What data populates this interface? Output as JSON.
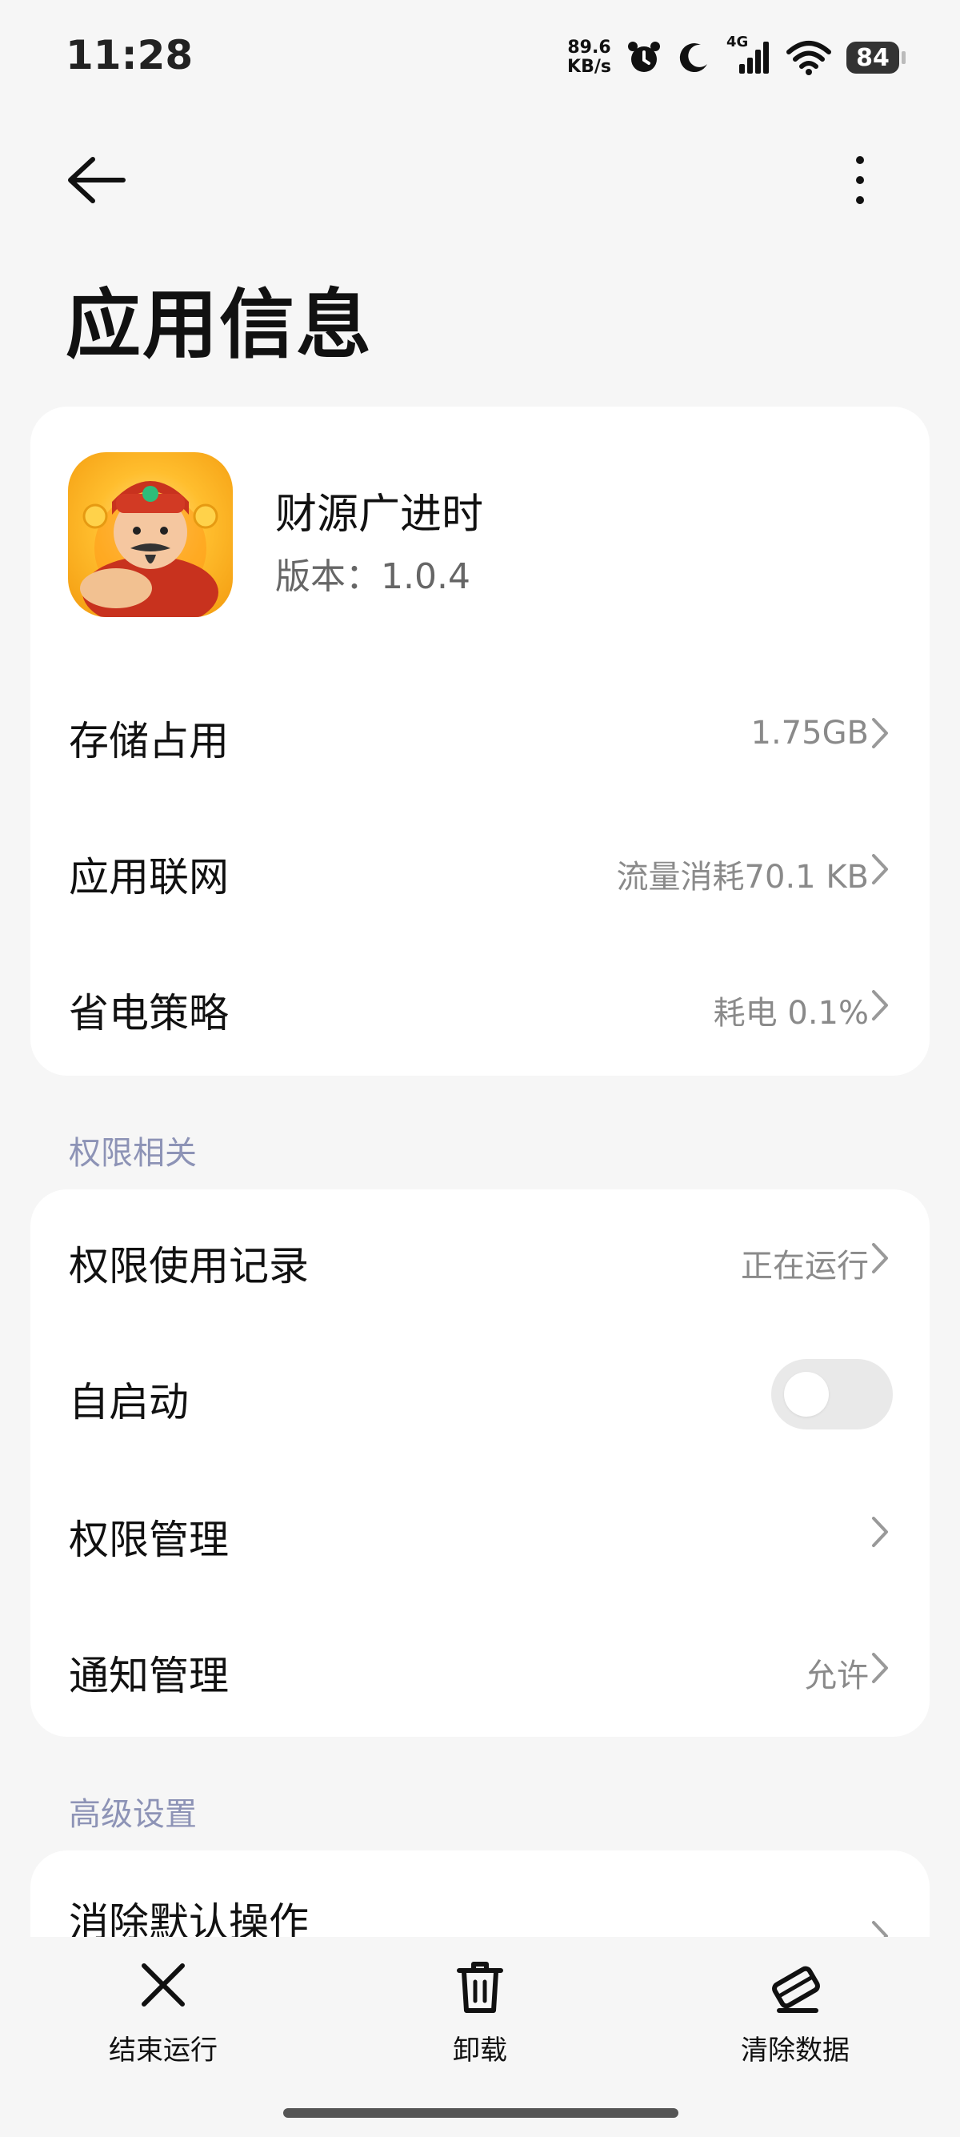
{
  "status_bar": {
    "time": "11:28",
    "net_speed_value": "89.6",
    "net_speed_unit": "KB/s",
    "network": "4G",
    "battery": "84"
  },
  "header": {
    "title": "应用信息"
  },
  "app": {
    "name": "财源广进时",
    "version": "版本：1.0.4"
  },
  "info_rows": [
    {
      "label": "存储占用",
      "value": "1.75GB"
    },
    {
      "label": "应用联网",
      "value": "流量消耗70.1 KB"
    },
    {
      "label": "省电策略",
      "value": "耗电 0.1%"
    }
  ],
  "permissions": {
    "section_title": "权限相关",
    "rows": [
      {
        "label": "权限使用记录",
        "value": "正在运行"
      },
      {
        "label": "自启动",
        "toggle_on": false
      },
      {
        "label": "权限管理",
        "value": ""
      },
      {
        "label": "通知管理",
        "value": "允许"
      }
    ]
  },
  "advanced": {
    "section_title": "高级设置",
    "rows": [
      {
        "label": "消除默认操作"
      }
    ]
  },
  "bottom_actions": [
    {
      "label": "结束运行",
      "icon": "close-icon"
    },
    {
      "label": "卸载",
      "icon": "trash-icon"
    },
    {
      "label": "清除数据",
      "icon": "eraser-icon"
    }
  ]
}
